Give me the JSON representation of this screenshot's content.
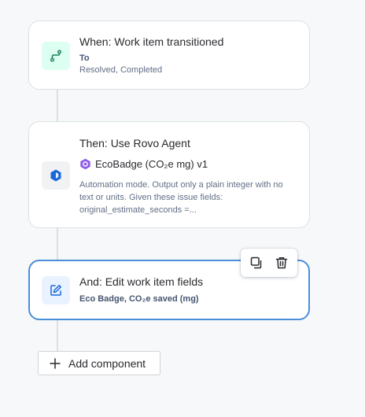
{
  "trigger": {
    "title": "When: Work item transitioned",
    "field_label": "To",
    "field_value": "Resolved, Completed",
    "icon": "branch-icon"
  },
  "action_agent": {
    "title": "Then: Use Rovo Agent",
    "agent_name": "EcoBadge (CO₂e mg) v1",
    "agent_icon": "rovo-agent-icon",
    "description": "Automation mode. Output only a plain integer with no text or units. Given these issue fields: original_estimate_seconds =...",
    "icon": "rovo-hexagon-icon"
  },
  "action_edit": {
    "title": "And: Edit work item fields",
    "fields": "Eco Badge, CO₂e saved (mg)",
    "icon": "edit-pencil-icon"
  },
  "toolbar": {
    "duplicate_icon": "duplicate-icon",
    "delete_icon": "trash-icon"
  },
  "add_component": {
    "label": "Add component",
    "icon": "plus-icon"
  },
  "colors": {
    "trigger_bg": "#dcfff1",
    "trigger_icon": "#1f845a",
    "agent_bg": "#f1f2f4",
    "agent_icon": "#1868db",
    "edit_bg": "#e9f2ff",
    "edit_icon": "#1868db",
    "selected_border": "#4a8fd8",
    "agent_badge": "#8f5ce4"
  }
}
